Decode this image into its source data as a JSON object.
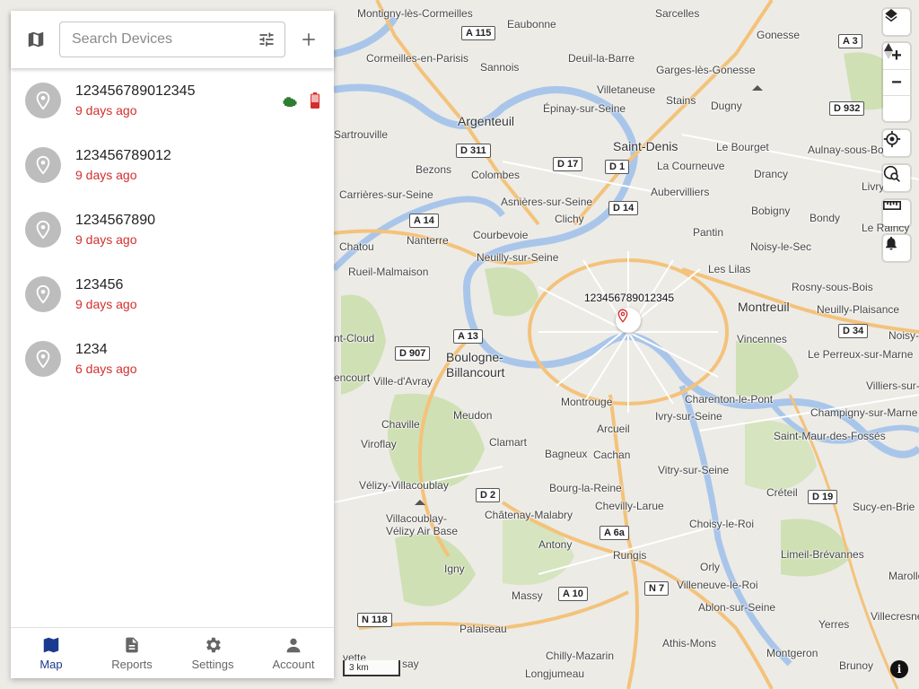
{
  "search": {
    "placeholder": "Search Devices"
  },
  "devices": [
    {
      "name": "123456789012345",
      "last_seen": "9 days ago"
    },
    {
      "name": "123456789012",
      "last_seen": "9 days ago"
    },
    {
      "name": "1234567890",
      "last_seen": "9 days ago"
    },
    {
      "name": "123456",
      "last_seen": "9 days ago"
    },
    {
      "name": "1234",
      "last_seen": "6 days ago"
    }
  ],
  "nav": {
    "map": "Map",
    "reports": "Reports",
    "settings": "Settings",
    "account": "Account"
  },
  "map": {
    "marker_label": "123456789012345",
    "scale": "3 km",
    "zoom_in": "+",
    "zoom_out": "−",
    "info": "i",
    "places": [
      "Montigny-lès-Cormeilles",
      "Eaubonne",
      "Sarcelles",
      "Gonesse",
      "Cormeilles-en-Parisis",
      "Sannois",
      "Deuil-la-Barre",
      "Garges-lès-Gonesse",
      "Villetaneuse",
      "Stains",
      "Dugny",
      "Argenteuil",
      "Épinay-sur-Seine",
      "Sartrouville",
      "Saint-Denis",
      "Le Bourget",
      "Aulnay-sous-Bo",
      "Bezons",
      "Colombes",
      "La Courneuve",
      "Drancy",
      "Livry",
      "Carrières-sur-Seine",
      "Asnières-sur-Seine",
      "Aubervilliers",
      "Clichy",
      "Bobigny",
      "Bondy",
      "Le Raincy",
      "Chatou",
      "Nanterre",
      "Courbevoie",
      "Pantin",
      "Noisy-le-Sec",
      "Rueil-Malmaison",
      "Neuilly-sur-Seine",
      "Les Lilas",
      "Rosny-sous-Bois",
      "Montreuil",
      "Neuilly-Plaisance",
      "nt-Cloud",
      "Vincennes",
      "Noisy-",
      "Boulogne-",
      "Billancourt",
      "Le Perreux-sur-Marne",
      "encourt",
      "Ville-d'Avray",
      "Montrouge",
      "Charenton-le-Pont",
      "Villiers-sur-",
      "Meudon",
      "Ivry-sur-Seine",
      "Champigny-sur-Marne",
      "Chaville",
      "Arcueil",
      "Saint-Maur-des-Fossés",
      "Viroflay",
      "Clamart",
      "Bagneux",
      "Cachan",
      "Vitry-sur-Seine",
      "Vélizy-Villacoublay",
      "Bourg-la-Reine",
      "Créteil",
      "Chevilly-Larue",
      "Sucy-en-Brie",
      "Villacoublay-",
      "Vélizy Air Base",
      "Châtenay-Malabry",
      "Choisy-le-Roi",
      "Antony",
      "Rungis",
      "Limeil-Brévannes",
      "Igny",
      "Orly",
      "Marolles",
      "Massy",
      "Villeneuve-le-Roi",
      "Villecresne",
      "Ablon-sur-Seine",
      "Palaiseau",
      "Yerres",
      "Athis-Mons",
      "Chilly-Mazarin",
      "Montgeron",
      "Brunoy",
      "Longjumeau",
      "vette",
      "say"
    ],
    "roads": [
      "A 115",
      "A 3",
      "D 932",
      "D 311",
      "D 17",
      "D 1",
      "A 14",
      "D 14",
      "A 13",
      "D 907",
      "D 34",
      "D 2",
      "D 19",
      "A 6a",
      "A 10",
      "N 7",
      "N 118"
    ]
  }
}
